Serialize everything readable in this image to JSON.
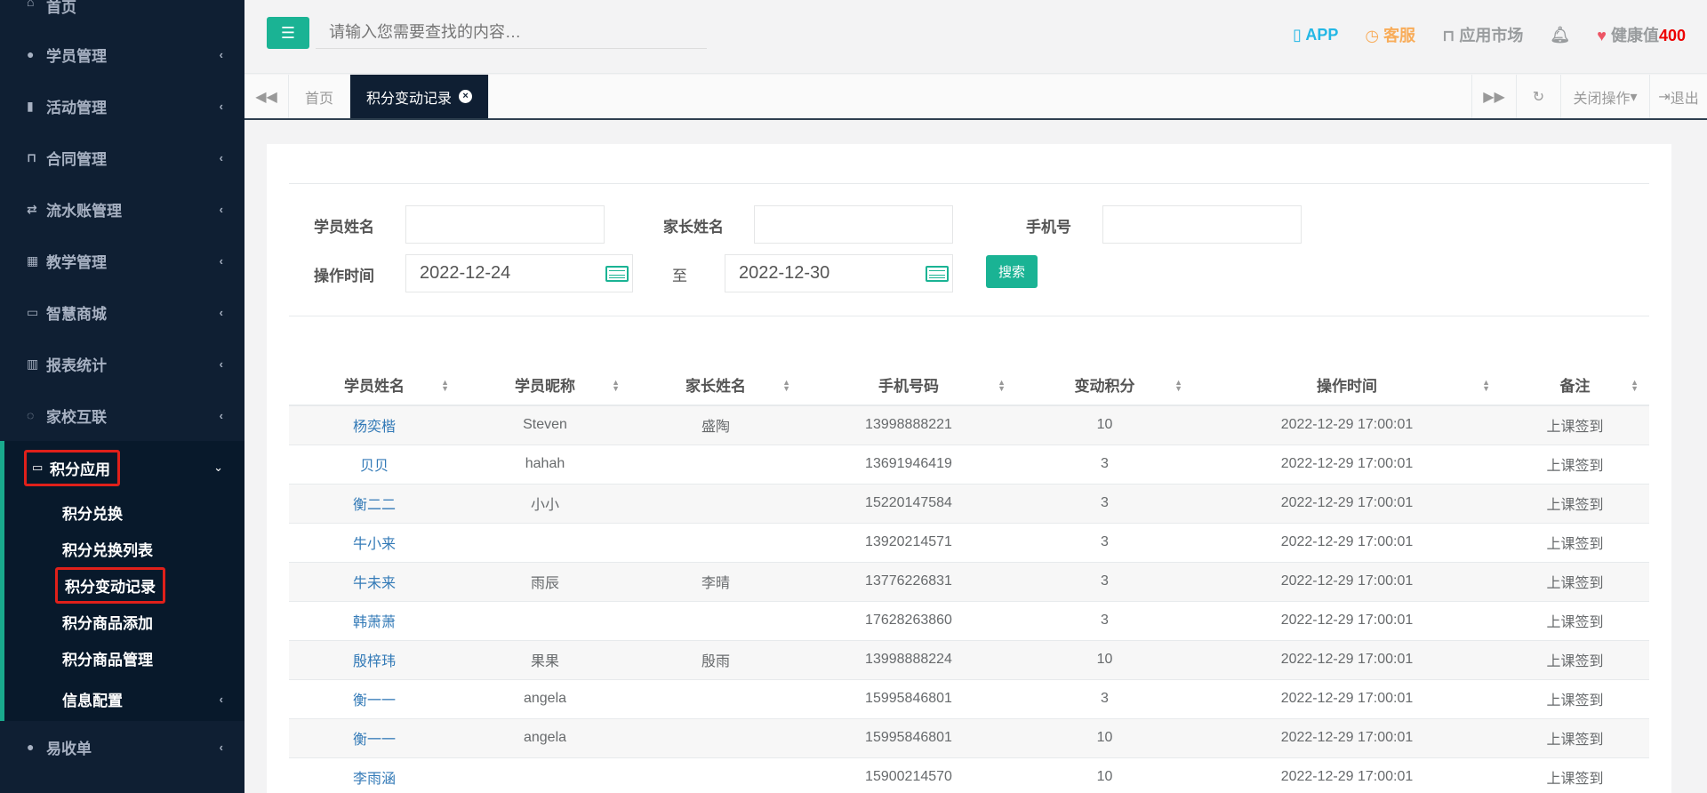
{
  "sidebar": {
    "home": "首页",
    "items": [
      {
        "label": "学员管理",
        "icon": "users-icon"
      },
      {
        "label": "活动管理",
        "icon": "map-icon"
      },
      {
        "label": "合同管理",
        "icon": "cart-icon"
      },
      {
        "label": "流水账管理",
        "icon": "retweet-icon"
      },
      {
        "label": "教学管理",
        "icon": "calendar-icon"
      },
      {
        "label": "智慧商城",
        "icon": "inbox-icon"
      },
      {
        "label": "报表统计",
        "icon": "bar-chart-icon"
      },
      {
        "label": "家校互联",
        "icon": "comments-icon"
      }
    ],
    "active": {
      "label": "积分应用",
      "subitems": [
        "积分兑换",
        "积分兑换列表",
        "积分变动记录",
        "积分商品添加",
        "积分商品管理",
        "信息配置"
      ]
    },
    "last": "易收单"
  },
  "header": {
    "search_placeholder": "请输入您需要查找的内容…",
    "app": "APP",
    "kefu": "客服",
    "market": "应用市场",
    "health_label": "健康值",
    "health_value": "400"
  },
  "tabs": {
    "home": "首页",
    "current": "积分变动记录",
    "close_ops": "关闭操作",
    "logout": "退出"
  },
  "filters": {
    "student_name_label": "学员姓名",
    "parent_name_label": "家长姓名",
    "phone_label": "手机号",
    "time_label": "操作时间",
    "date_from": "2022-12-24",
    "to_label": "至",
    "date_to": "2022-12-30",
    "search_btn": "搜索"
  },
  "table": {
    "headers": [
      "学员姓名",
      "学员昵称",
      "家长姓名",
      "手机号码",
      "变动积分",
      "操作时间",
      "备注"
    ],
    "rows": [
      [
        "杨奕楷",
        "Steven",
        "盛陶",
        "13998888221",
        "10",
        "2022-12-29 17:00:01",
        "上课签到"
      ],
      [
        "贝贝",
        "hahah",
        "",
        "13691946419",
        "3",
        "2022-12-29 17:00:01",
        "上课签到"
      ],
      [
        "衡二二",
        "小小",
        "",
        "15220147584",
        "3",
        "2022-12-29 17:00:01",
        "上课签到"
      ],
      [
        "牛小来",
        "",
        "",
        "13920214571",
        "3",
        "2022-12-29 17:00:01",
        "上课签到"
      ],
      [
        "牛未来",
        "雨辰",
        "李晴",
        "13776226831",
        "3",
        "2022-12-29 17:00:01",
        "上课签到"
      ],
      [
        "韩萧萧",
        "",
        "",
        "17628263860",
        "3",
        "2022-12-29 17:00:01",
        "上课签到"
      ],
      [
        "殷梓玮",
        "果果",
        "殷雨",
        "13998888224",
        "10",
        "2022-12-29 17:00:01",
        "上课签到"
      ],
      [
        "衡一一",
        "angela",
        "",
        "15995846801",
        "3",
        "2022-12-29 17:00:01",
        "上课签到"
      ],
      [
        "衡一一",
        "angela",
        "",
        "15995846801",
        "10",
        "2022-12-29 17:00:01",
        "上课签到"
      ],
      [
        "李雨涵",
        "",
        "",
        "15900214570",
        "10",
        "2022-12-29 17:00:01",
        "上课签到"
      ]
    ]
  }
}
